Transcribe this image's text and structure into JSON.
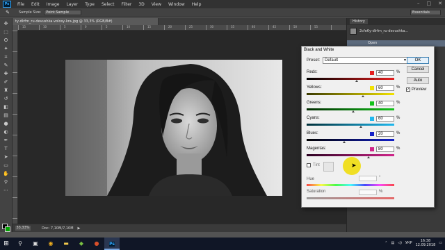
{
  "menubar": {
    "logo": "Ps",
    "items": [
      "File",
      "Edit",
      "Image",
      "Layer",
      "Type",
      "Select",
      "Filter",
      "3D",
      "View",
      "Window",
      "Help"
    ],
    "win_controls": [
      "–",
      "□",
      "✕"
    ]
  },
  "options_bar": {
    "tool_icon": "eyedropper-icon",
    "sample_size_label": "Sample Size:",
    "sample_size_value": "Point Sample",
    "workspace": "Essentials"
  },
  "document": {
    "tab_title": "ty-dlrfm_ru-devushka-volosy-kra.jpg @ 33,3% (RGB/8#)",
    "ruler_numbers": [
      "15",
      "10",
      "5",
      "0",
      "5",
      "10",
      "15",
      "20",
      "25",
      "30",
      "35",
      "40",
      "45",
      "50",
      "55"
    ]
  },
  "status_bar": {
    "zoom": "33,33%",
    "doc_size": "Doc: 7,10M/7,10M",
    "arrow": "▶"
  },
  "history_panel": {
    "title": "History",
    "snapshot_name": "2cfe6y-dlrfm_ru-devushka...",
    "open_item": "Open"
  },
  "dialog": {
    "title": "Black and White",
    "preset_label": "Preset:",
    "preset_value": "Default",
    "ok": "OK",
    "cancel": "Cancel",
    "auto": "Auto",
    "preview_label": "Preview",
    "sliders": [
      {
        "label": "Reds:",
        "value": "40",
        "color": "#e41e1e",
        "track": "linear-gradient(90deg,#000,#e41e1e)"
      },
      {
        "label": "Yellows:",
        "value": "60",
        "color": "#f2e200",
        "track": "linear-gradient(90deg,#3a3a00,#f2e200)"
      },
      {
        "label": "Greens:",
        "value": "40",
        "color": "#12c21a",
        "track": "linear-gradient(90deg,#002a00,#12c21a)"
      },
      {
        "label": "Cyans:",
        "value": "60",
        "color": "#1fb8ee",
        "track": "linear-gradient(90deg,#00303a,#1fb8ee)"
      },
      {
        "label": "Blues:",
        "value": "20",
        "color": "#1320c8",
        "track": "linear-gradient(90deg,#000,#1320c8)"
      },
      {
        "label": "Magentas:",
        "value": "80",
        "color": "#d0248a",
        "track": "linear-gradient(90deg,#2a0020,#d0248a)"
      }
    ],
    "slider_positions": [
      0.57,
      0.64,
      0.53,
      0.62,
      0.43,
      0.71
    ],
    "tint_label": "Tint",
    "hue_label": "Hue",
    "hue_unit": "°",
    "saturation_label": "Saturation",
    "saturation_unit": "%",
    "percent": "%"
  },
  "taskbar": {
    "lang": "УКР",
    "time": "16:38",
    "date": "12.09.2018",
    "ps_label": "Ps"
  }
}
